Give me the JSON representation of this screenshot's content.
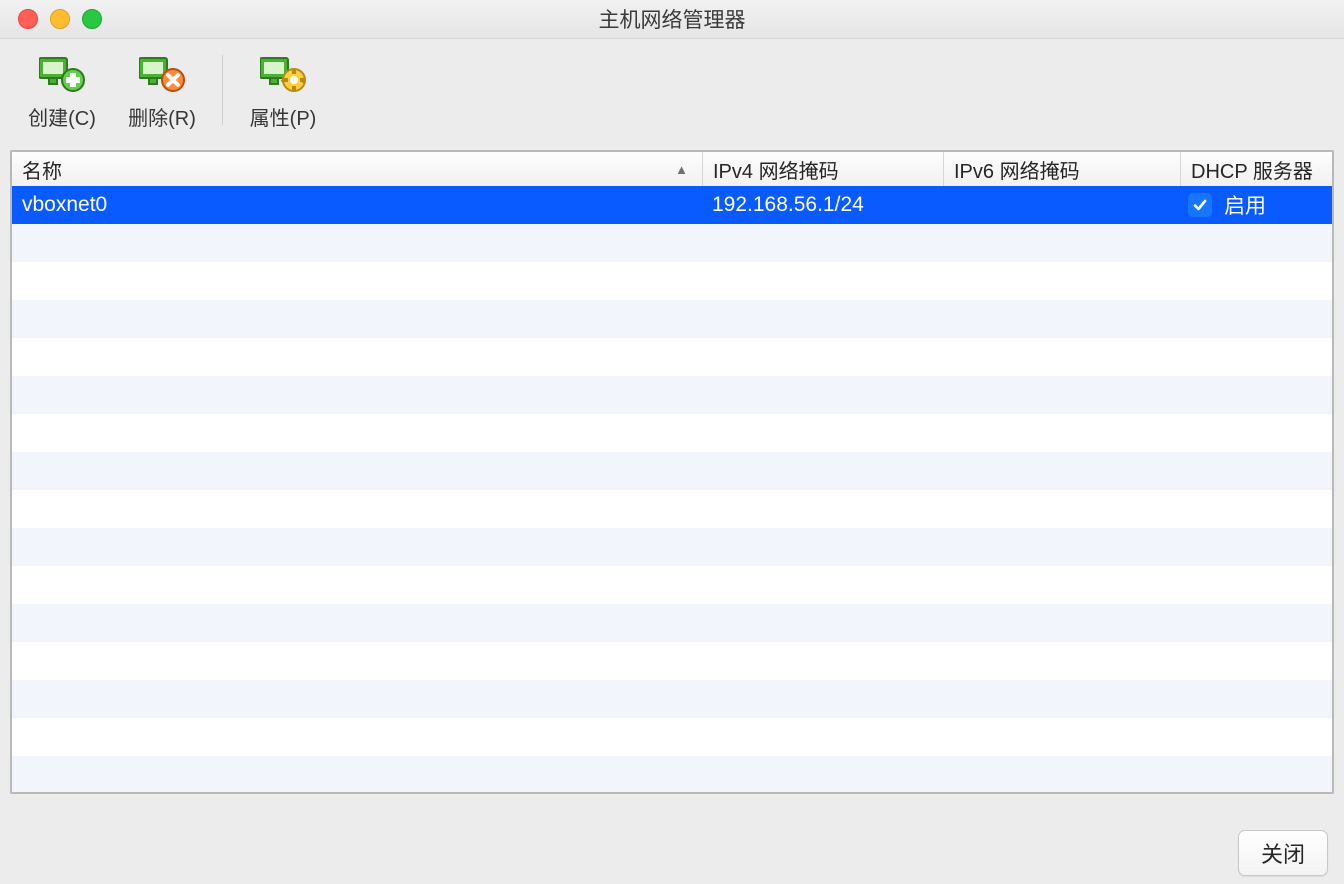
{
  "window": {
    "title": "主机网络管理器"
  },
  "toolbar": {
    "create": "创建(C)",
    "remove": "删除(R)",
    "properties": "属性(P)"
  },
  "columns": {
    "name": "名称",
    "ipv4": "IPv4 网络掩码",
    "ipv6": "IPv6 网络掩码",
    "dhcp": "DHCP 服务器",
    "sort_glyph": "▲"
  },
  "rows": [
    {
      "name": "vboxnet0",
      "ipv4": "192.168.56.1/24",
      "ipv6": "",
      "dhcp_enabled": true,
      "dhcp_label": "启用",
      "selected": true
    }
  ],
  "footer": {
    "close": "关闭"
  },
  "icons": {
    "create": "network-add-icon",
    "remove": "network-remove-icon",
    "properties": "network-settings-icon"
  }
}
